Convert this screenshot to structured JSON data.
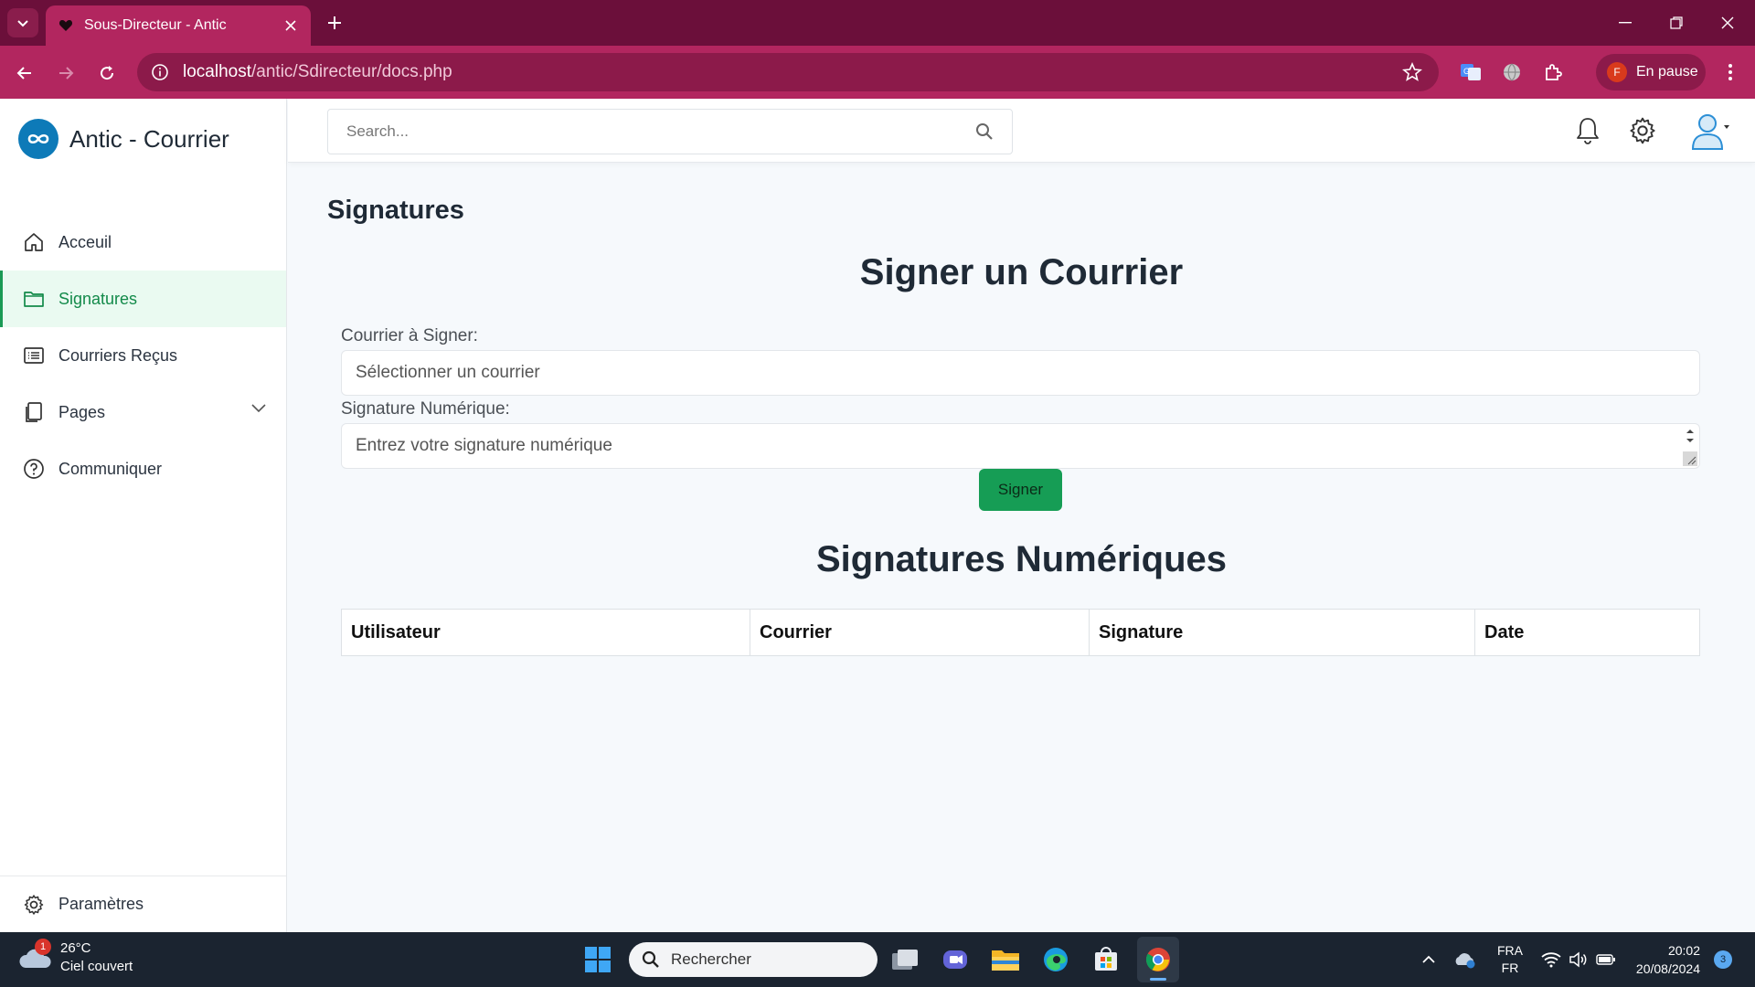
{
  "browser": {
    "tab_title": "Sous-Directeur - Antic",
    "url_host": "localhost",
    "url_path": "/antic/Sdirecteur/docs.php",
    "profile_initial": "F",
    "profile_label": "En pause"
  },
  "app": {
    "brand": "Antic - Courrier",
    "search_placeholder": "Search..."
  },
  "sidebar": {
    "items": [
      {
        "label": "Acceuil",
        "icon": "home-icon"
      },
      {
        "label": "Signatures",
        "icon": "folder-icon",
        "active": true
      },
      {
        "label": "Courriers Reçus",
        "icon": "list-icon"
      },
      {
        "label": "Pages",
        "icon": "pages-icon"
      },
      {
        "label": "Communiquer",
        "icon": "help-circle-icon"
      }
    ],
    "bottom_label": "Paramètres"
  },
  "main": {
    "page_title": "Signatures",
    "form_title": "Signer un Courrier",
    "courrier_label": "Courrier à Signer:",
    "courrier_value": "Sélectionner un courrier",
    "signature_label": "Signature Numérique:",
    "signature_placeholder": "Entrez votre signature numérique",
    "submit_label": "Signer",
    "table_title": "Signatures Numériques",
    "table_headers": [
      "Utilisateur",
      "Courrier",
      "Signature",
      "Date"
    ]
  },
  "taskbar": {
    "weather_badge": "1",
    "temperature": "26°C",
    "weather_desc": "Ciel couvert",
    "search_placeholder": "Rechercher",
    "lang_top": "FRA",
    "lang_bottom": "FR",
    "time": "20:02",
    "date": "20/08/2024",
    "notif_count": "3"
  },
  "colors": {
    "browser_frame": "#6b0f3a",
    "browser_toolbar": "#b2265f",
    "accent_green": "#169d55",
    "brand_blue": "#0d7ab8"
  }
}
